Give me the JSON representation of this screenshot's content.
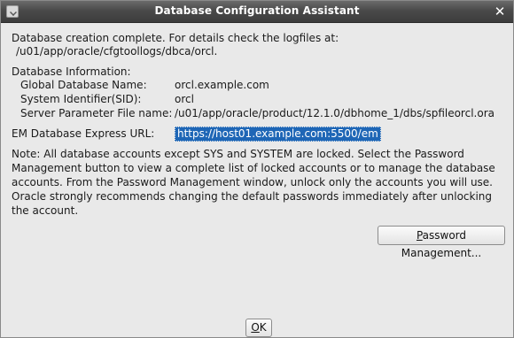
{
  "window": {
    "title": "Database Configuration Assistant"
  },
  "message": {
    "completion_line1": "Database creation complete. For details check the logfiles at:",
    "completion_line2": "/u01/app/oracle/cfgtoollogs/dbca/orcl.",
    "info_heading": "Database Information:",
    "fields": [
      {
        "label": "Global Database Name:",
        "value": "orcl.example.com"
      },
      {
        "label": "System Identifier(SID):",
        "value": "orcl"
      },
      {
        "label": "Server Parameter File name:",
        "value": "/u01/app/oracle/product/12.1.0/dbhome_1/dbs/spfileorcl.ora"
      }
    ],
    "em_label": "EM Database Express URL:",
    "em_url": "https://host01.example.com:5500/em",
    "note": "Note: All database accounts except SYS and SYSTEM are locked. Select the Password Management button to view a complete list of locked accounts or to manage the database accounts. From the Password Management window, unlock only the accounts you will use. Oracle strongly recommends changing the default passwords immediately after unlocking the account."
  },
  "buttons": {
    "password_mnemonic": "P",
    "password_rest": "assword Management...",
    "ok_mnemonic": "O",
    "ok_rest": "K"
  },
  "icons": {
    "window_icon": "check-icon",
    "close_icon": "close-icon"
  },
  "colors": {
    "titlebar": "#4a4a4a",
    "dialog_bg": "#e9e9e9",
    "selection": "#1e66b6"
  }
}
